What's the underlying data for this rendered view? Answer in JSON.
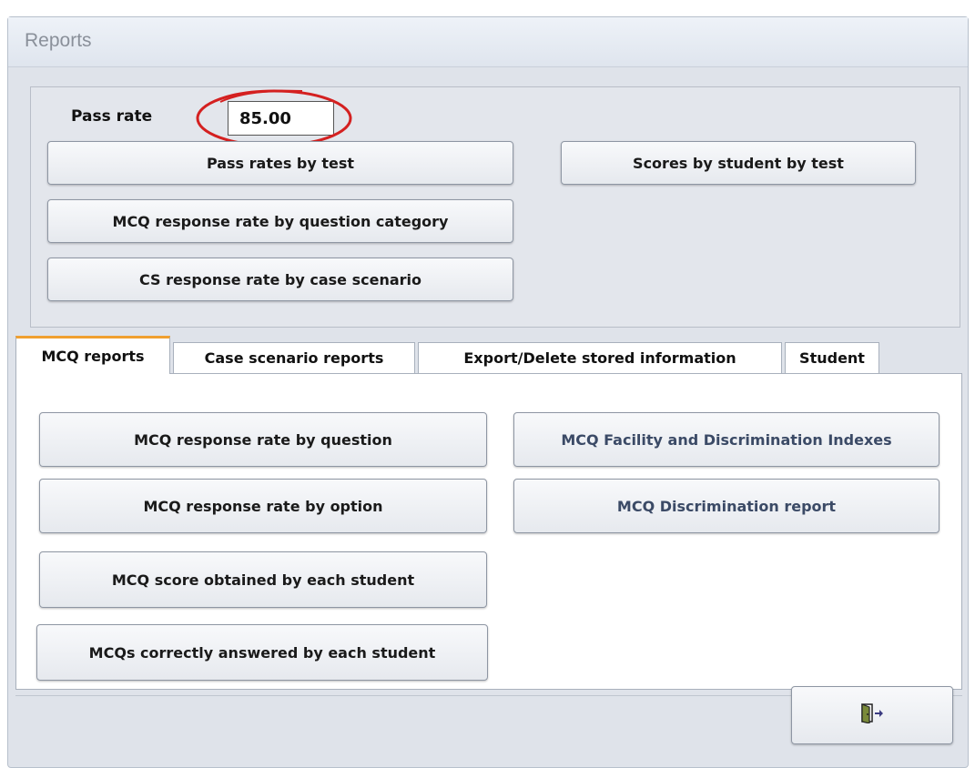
{
  "window": {
    "title": "Reports"
  },
  "pass_rate": {
    "label": "Pass rate",
    "value": "85.00"
  },
  "top_buttons": {
    "pass_rates_by_test": "Pass rates by test",
    "scores_by_student": "Scores by student by test",
    "mcq_by_category": "MCQ response rate by question category",
    "cs_by_scenario": "CS response rate by case scenario"
  },
  "tabs": [
    {
      "label": "MCQ reports",
      "active": true
    },
    {
      "label": "Case scenario reports",
      "active": false
    },
    {
      "label": "Export/Delete stored information",
      "active": false
    },
    {
      "label": "Student",
      "active": false
    }
  ],
  "mcq_tab": {
    "by_question": "MCQ response rate by question",
    "by_option": "MCQ response rate by option",
    "score_each_student": "MCQ score obtained by each student",
    "correct_each_student": "MCQs correctly answered by each student",
    "facility_indexes": "MCQ Facility and Discrimination Indexes",
    "discrimination_report": "MCQ Discrimination report"
  },
  "footer": {
    "exit_icon": "exit-door-icon"
  },
  "colors": {
    "tab_active_accent": "#f0a030",
    "annotation_circle": "#d42020"
  }
}
